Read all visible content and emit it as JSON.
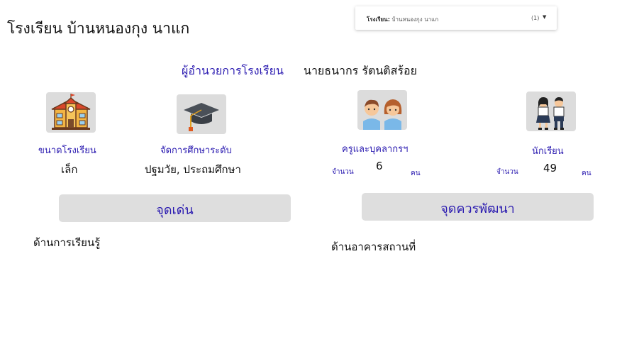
{
  "header": {
    "school_name": "โรงเรียน บ้านหนองกุง นาแก"
  },
  "filter": {
    "label": "โรงเรียน:",
    "value": "บ้านหนองกุง นาแก",
    "count": "(1)"
  },
  "director": {
    "label": "ผู้อำนวยการโรงเรียน",
    "name": "นายธนากร รัตนติสร้อย"
  },
  "stats": {
    "size": {
      "label": "ขนาดโรงเรียน",
      "value": "เล็ก",
      "icon": "school-building-icon"
    },
    "education_level": {
      "label": "จัดการศึกษาระดับ",
      "value": "ปฐมวัย, ประถมศึกษา",
      "icon": "graduation-cap-icon"
    },
    "teachers": {
      "label": "ครูและบุคลากรฯ",
      "prefix": "จำนวน",
      "value": "6",
      "unit": "คน",
      "icon": "teachers-icon"
    },
    "students": {
      "label": "นักเรียน",
      "prefix": "จำนวน",
      "value": "49",
      "unit": "คน",
      "icon": "students-icon"
    }
  },
  "strengths": {
    "button_label": "จุดเด่น",
    "items": [
      "ด้านการเรียนรู้"
    ]
  },
  "improvements": {
    "button_label": "จุดควรพัฒนา",
    "items": [
      "ด้านอาคารสถานที่"
    ]
  },
  "colors": {
    "accent": "#2a1ab0",
    "button_bg": "#dedede",
    "icon_bg": "#dcdcdc"
  }
}
